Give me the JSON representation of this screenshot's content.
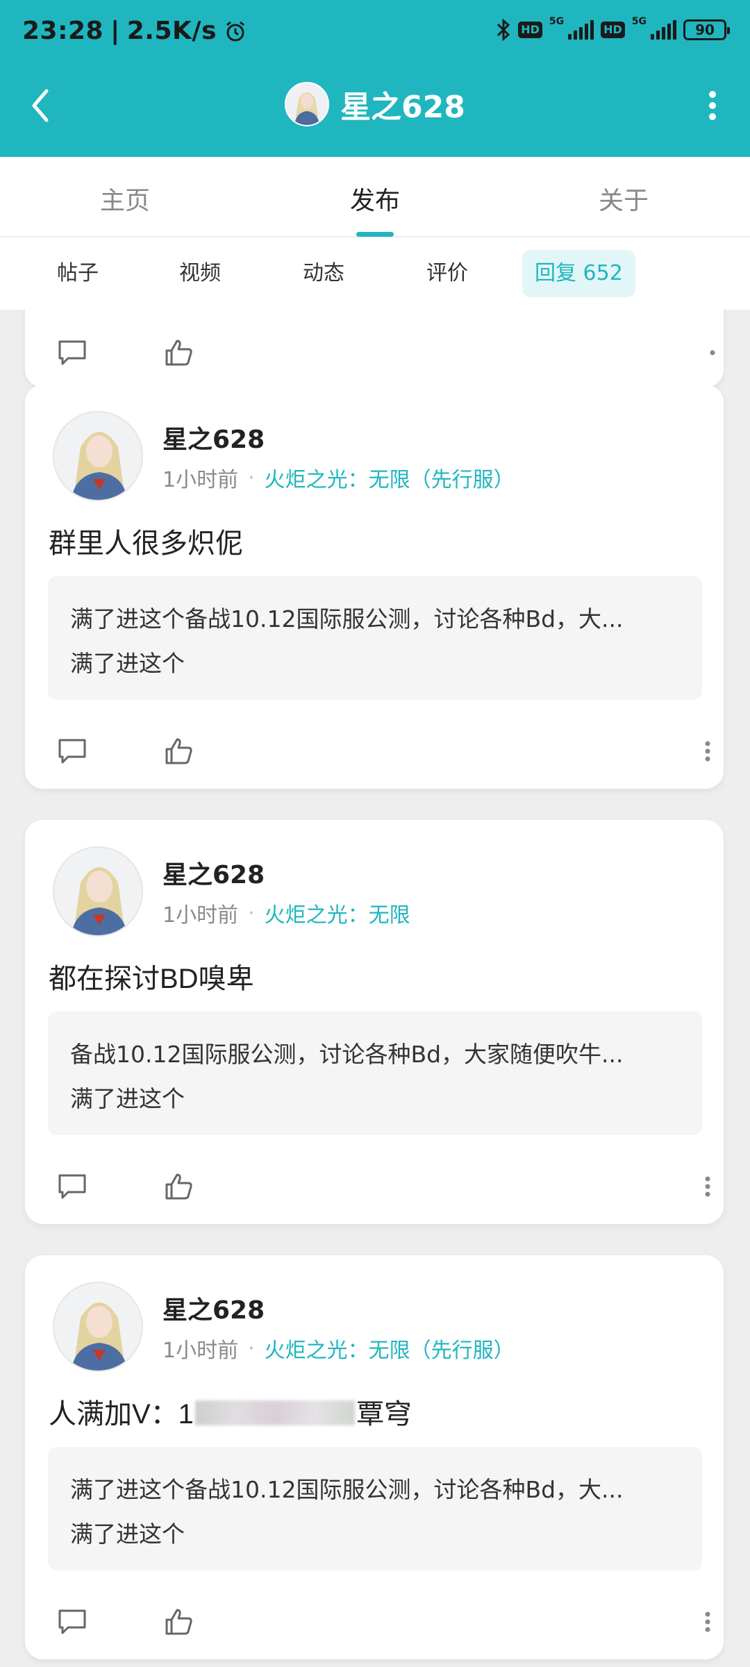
{
  "status_bar": {
    "time": "23:28",
    "speed": "2.5K/s",
    "battery": "90",
    "hd1": "HD",
    "hd2": "HD",
    "net1": "5G",
    "net2": "5G"
  },
  "header": {
    "title": "星之628"
  },
  "main_tabs": [
    {
      "label": "主页"
    },
    {
      "label": "发布"
    },
    {
      "label": "关于"
    }
  ],
  "sub_tabs": [
    {
      "label": "帖子"
    },
    {
      "label": "视频"
    },
    {
      "label": "动态"
    },
    {
      "label": "评价"
    },
    {
      "label": "回复 652"
    }
  ],
  "posts": [
    {
      "username": "星之628",
      "time": "1小时前",
      "separator": "·",
      "game": "火炬之光：无限（先行服）",
      "title": "群里人很多炽伲",
      "quote_line1": "满了进这个备战10.12国际服公测，讨论各种Bd，大...",
      "quote_line2": "满了进这个"
    },
    {
      "username": "星之628",
      "time": "1小时前",
      "separator": "·",
      "game": "火炬之光：无限",
      "title": "都在探讨BD嗅卑",
      "quote_line1": "备战10.12国际服公测，讨论各种Bd，大家随便吹牛...",
      "quote_line2": "满了进这个"
    },
    {
      "username": "星之628",
      "time": "1小时前",
      "separator": "·",
      "game": "火炬之光：无限（先行服）",
      "title_prefix": "人满加V：1",
      "title_suffix": "覃穹",
      "quote_line1": "满了进这个备战10.12国际服公测，讨论各种Bd，大...",
      "quote_line2": "满了进这个"
    }
  ],
  "colors": {
    "accent": "#1fb6bf",
    "background": "#eeeeee"
  }
}
